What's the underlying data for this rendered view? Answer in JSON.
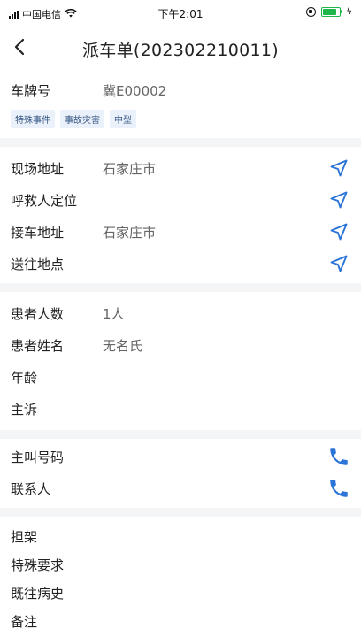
{
  "status_bar": {
    "carrier": "中国电信",
    "time": "下午2:01"
  },
  "nav": {
    "title": "派车单(202302210011)"
  },
  "vehicle": {
    "plate_label": "车牌号",
    "plate_value": "冀E00002",
    "tags": [
      "特殊事件",
      "事故灾害",
      "中型"
    ]
  },
  "addresses": {
    "scene_label": "现场地址",
    "scene_value": "石家庄市",
    "caller_location_label": "呼救人定位",
    "caller_location_value": "",
    "pickup_label": "接车地址",
    "pickup_value": "石家庄市",
    "destination_label": "送往地点",
    "destination_value": ""
  },
  "patient": {
    "count_label": "患者人数",
    "count_value": "1人",
    "name_label": "患者姓名",
    "name_value": "无名氏",
    "age_label": "年龄",
    "age_value": "",
    "complaint_label": "主诉",
    "complaint_value": ""
  },
  "contact": {
    "caller_number_label": "主叫号码",
    "caller_number_value": "",
    "contact_person_label": "联系人",
    "contact_person_value": ""
  },
  "extra": {
    "stretcher_label": "担架",
    "special_req_label": "特殊要求",
    "history_label": "既往病史",
    "notes_label": "备注"
  },
  "colors": {
    "accent": "#2b74d8",
    "divider": "#f4f5f7",
    "tag_bg": "#eaf1fb"
  }
}
